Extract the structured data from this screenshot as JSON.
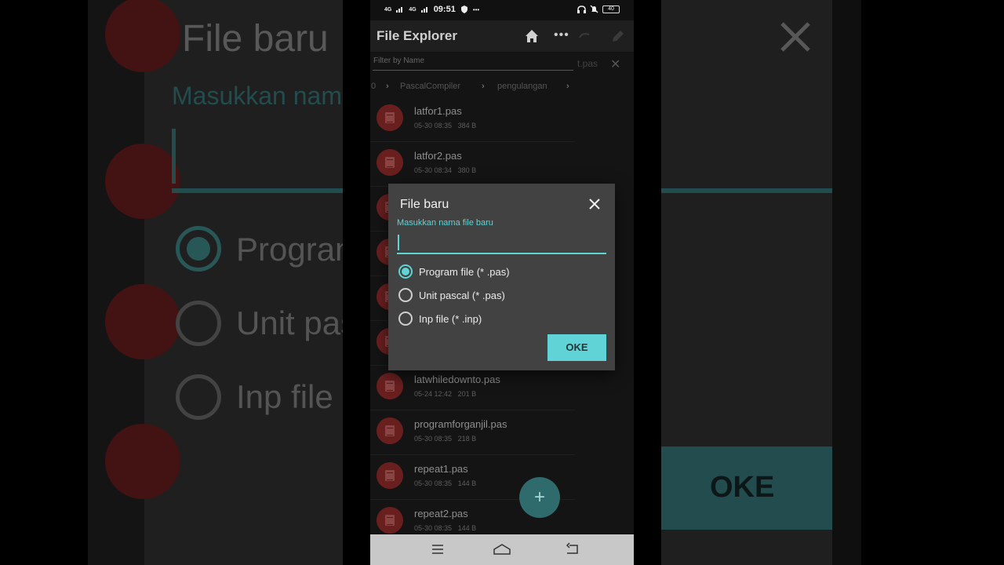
{
  "status_bar": {
    "signal1": "4G",
    "signal2": "4G",
    "time": "09:51",
    "dots": "•••",
    "battery": "40"
  },
  "app_bar": {
    "title": "File Explorer",
    "more_label": "•••"
  },
  "filter": {
    "placeholder": "Filter by Name"
  },
  "breadcrumb": {
    "items": [
      "0",
      "PascalCompiler",
      "pengulangan"
    ],
    "separator": "›"
  },
  "background_tab": {
    "name": "t.pas",
    "close": "✕"
  },
  "files": [
    {
      "name": "latfor1.pas",
      "date": "05-30 08:35",
      "size": "384 B"
    },
    {
      "name": "latfor2.pas",
      "date": "05-30 08:34",
      "size": "380 B"
    },
    {
      "name": "latwhiledownto.pas",
      "date": "05-24 12:42",
      "size": "201 B"
    },
    {
      "name": "programforganjil.pas",
      "date": "05-30 08:35",
      "size": "218 B"
    },
    {
      "name": "repeat1.pas",
      "date": "05-30 08:35",
      "size": "144 B"
    },
    {
      "name": "repeat2.pas",
      "date": "05-30 08:35",
      "size": "144 B"
    }
  ],
  "fab": {
    "label": "+"
  },
  "dialog": {
    "title": "File baru",
    "input_label": "Masukkan nama file baru",
    "input_value": "",
    "options": [
      {
        "label": "Program file (* .pas)",
        "selected": true
      },
      {
        "label": "Unit pascal (* .pas)",
        "selected": false
      },
      {
        "label": "Inp file (* .inp)",
        "selected": false
      }
    ],
    "ok_label": "OKE"
  },
  "background_zoom": {
    "title": "File baru",
    "label": "Masukkan nama",
    "opt1": "Program",
    "opt2": "Unit pas",
    "opt3": "Inp file",
    "ok": "OKE"
  },
  "colors": {
    "accent": "#5fd3d6",
    "dialog_bg": "#424242",
    "file_icon": "#6a1f1f"
  }
}
